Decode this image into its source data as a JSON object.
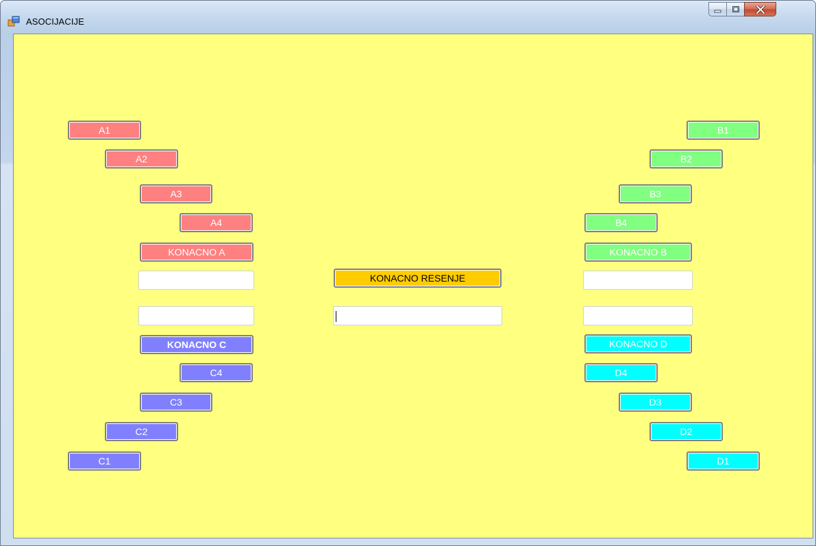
{
  "window": {
    "title": "ASOCIJACIJE",
    "controls": {
      "minimize_icon": "minimize-icon",
      "maximize_icon": "maximize-icon",
      "close_icon": "close-icon"
    }
  },
  "column_a": {
    "color": "#ff8080",
    "fields": [
      "A1",
      "A2",
      "A3",
      "A4"
    ],
    "final": "KONACNO A"
  },
  "column_b": {
    "color": "#80ff80",
    "fields": [
      "B1",
      "B2",
      "B3",
      "B4"
    ],
    "final": "KONACNO B"
  },
  "column_c": {
    "color": "#8080ff",
    "fields": [
      "C1",
      "C2",
      "C3",
      "C4"
    ],
    "final": "KONACNO C"
  },
  "column_d": {
    "color": "#00ffff",
    "fields": [
      "D1",
      "D2",
      "D3",
      "D4"
    ],
    "final": "KONACNO D"
  },
  "center": {
    "final_solution_label": "KONACNO RESENJE",
    "final_solution_input": ""
  },
  "inputs": {
    "a_answer": "",
    "b_answer": "",
    "c_answer": "",
    "d_answer": ""
  },
  "colors": {
    "form_background": "#ffff80",
    "final_solution": "#ffcc00"
  }
}
